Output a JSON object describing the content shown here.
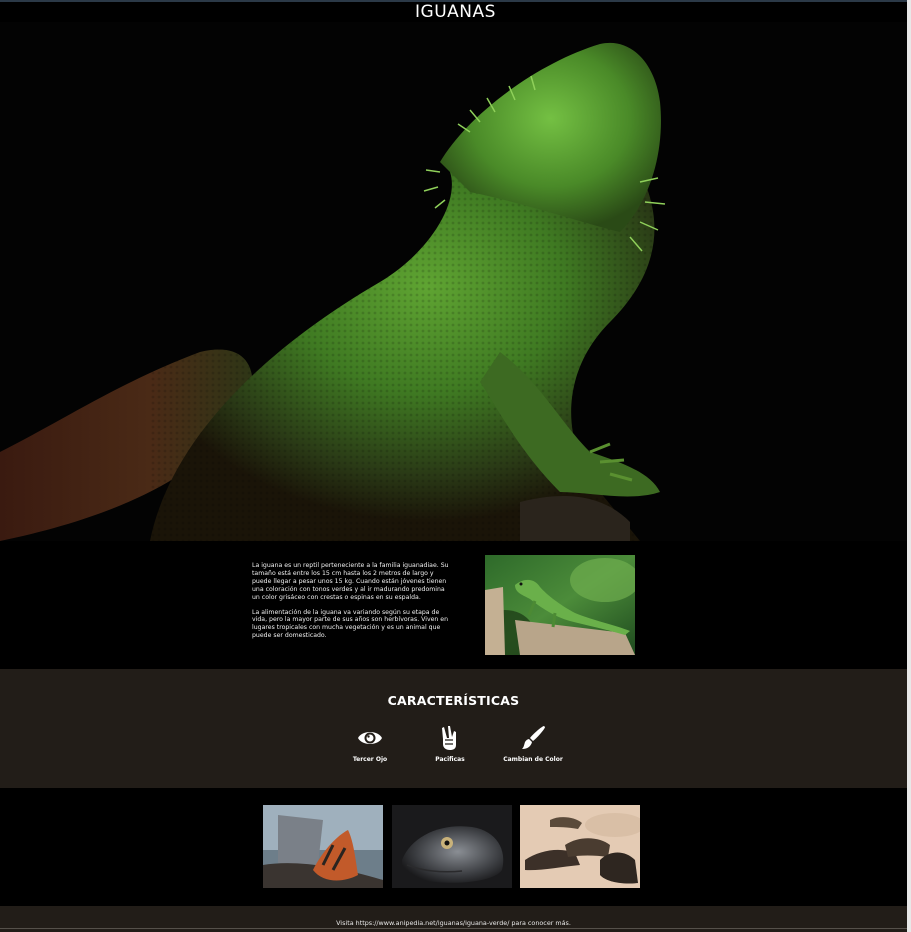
{
  "header": {
    "title": "IGUANAS"
  },
  "hero": {
    "image": "bearded-dragon-lizard-photo"
  },
  "intro": {
    "paragraph1": "La iguana es un reptil perteneciente a la familia iguanadiae. Su tamaño está entre los 15 cm hasta los 2 metros de largo y puede llegar a pesar unos 15 kg. Cuando están jóvenes tienen una coloración con tonos verdes y al ir madurando predomina un color grisáceo con crestas o espinas en su espalda.",
    "paragraph2": "La alimentación de la iguana va variando según su etapa de vida, pero la mayor parte de sus años son herbívoras. Viven en lugares tropicales con mucha vegetación y es un animal que puede ser domesticado.",
    "image": "green-iguana-on-stump-photo"
  },
  "features": {
    "title": "CARACTERÍSTICAS",
    "items": [
      {
        "icon": "eye-icon",
        "label": "Tercer Ojo"
      },
      {
        "icon": "peace-hand-icon",
        "label": "Pacificas"
      },
      {
        "icon": "paint-brush-icon",
        "label": "Cambian de Color"
      }
    ]
  },
  "gallery": {
    "images": [
      "marine-iguana-on-rock-photo",
      "iguana-head-closeup-photo",
      "iguanas-group-on-sand-photo"
    ]
  },
  "footer": {
    "text": "Visita https://www.anipedia.net/iguanas/iguana-verde/ para conocer más."
  },
  "colors": {
    "background": "#000000",
    "section_alt": "#221d18",
    "text": "#ffffff"
  }
}
